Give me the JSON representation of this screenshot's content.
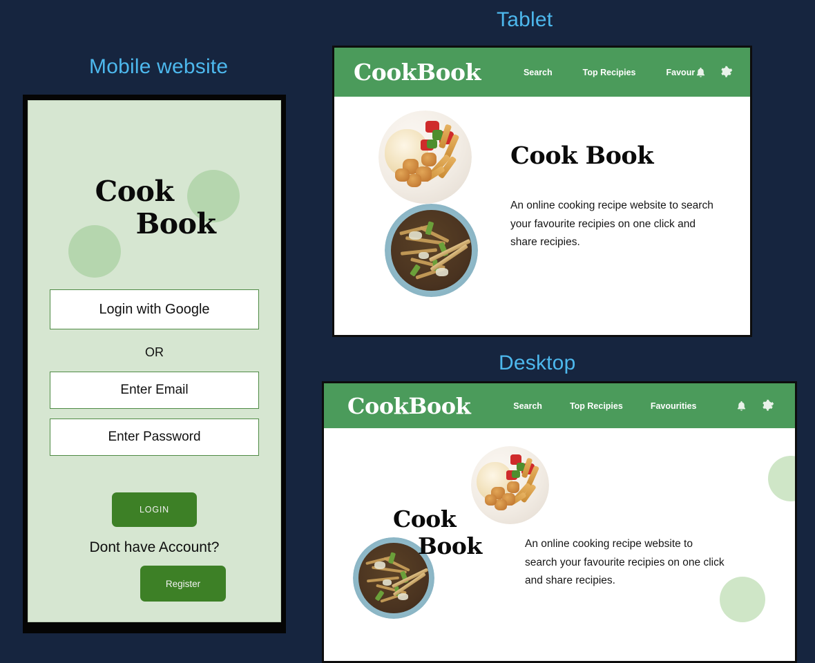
{
  "sections": {
    "mobile": "Mobile website",
    "tablet": "Tablet",
    "desktop": "Desktop"
  },
  "brand": {
    "word1": "Cook",
    "word2": "Book",
    "full": "CookBook"
  },
  "mobile_app": {
    "google_login_label": "Login with Google",
    "or_label": "OR",
    "email_placeholder": "Enter Email",
    "password_placeholder": "Enter Password",
    "login_button_label": "LOGIN",
    "no_account_text": "Dont have Account?",
    "register_button_label": "Register"
  },
  "tablet_app": {
    "nav": [
      {
        "label": "Search"
      },
      {
        "label": "Top Recipies"
      },
      {
        "label": "Favour"
      }
    ],
    "icons": [
      {
        "name": "bell-icon"
      },
      {
        "name": "gear-icon"
      }
    ],
    "hero_title": "Cook Book",
    "hero_description": "An online cooking recipe website to search your favourite recipies on one click and share recipies."
  },
  "desktop_app": {
    "nav": [
      {
        "label": "Search"
      },
      {
        "label": "Top Recipies"
      },
      {
        "label": "Favourities"
      }
    ],
    "icons": [
      {
        "name": "bell-icon"
      },
      {
        "name": "gear-icon"
      }
    ],
    "hero_description": "An online cooking recipe website to search your favourite recipies on one click and share recipies."
  },
  "colors": {
    "page_background": "#16253f",
    "section_title": "#4db8ed",
    "header_green": "#4b9b5b",
    "button_green": "#3d8026",
    "mint_screen": "#d6e6d1",
    "blob_green": "#b5d6ae",
    "white": "#ffffff"
  }
}
